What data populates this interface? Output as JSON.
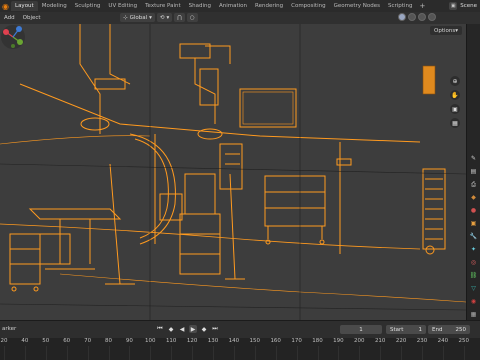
{
  "app": {
    "logo_icon": "blender-logo-icon",
    "tabs": [
      {
        "label": "Layout",
        "active": true
      },
      {
        "label": "Modeling",
        "active": false
      },
      {
        "label": "Sculpting",
        "active": false
      },
      {
        "label": "UV Editing",
        "active": false
      },
      {
        "label": "Texture Paint",
        "active": false
      },
      {
        "label": "Shading",
        "active": false
      },
      {
        "label": "Animation",
        "active": false
      },
      {
        "label": "Rendering",
        "active": false
      },
      {
        "label": "Compositing",
        "active": false
      },
      {
        "label": "Geometry Nodes",
        "active": false
      },
      {
        "label": "Scripting",
        "active": false
      }
    ],
    "add_tab": "+",
    "scene_label": "Scene"
  },
  "header": {
    "add_menu": "Add",
    "object_menu": "Object",
    "transform_orientation": "Global",
    "options_label": "Options"
  },
  "viewport": {
    "background_color": "#3d3d3d",
    "wire_color": "#ff9a1f",
    "dark_wire_color": "#1a1a1a"
  },
  "timeline": {
    "left_label": "arker",
    "current_frame": "1",
    "start_label": "Start",
    "start_value": "1",
    "end_label": "End",
    "end_value": "250",
    "ruler_ticks": [
      "20",
      "40",
      "50",
      "60",
      "70",
      "80",
      "90",
      "100",
      "110",
      "120",
      "130",
      "140",
      "150",
      "160",
      "170",
      "180",
      "190",
      "200",
      "210",
      "220",
      "230",
      "240",
      "250"
    ]
  },
  "colors": {
    "accent": "#e87d0d",
    "gizmo_x": "#e0414f",
    "gizmo_y": "#6aa533",
    "gizmo_z": "#3e7bd6",
    "playhead": "#4772b3"
  }
}
